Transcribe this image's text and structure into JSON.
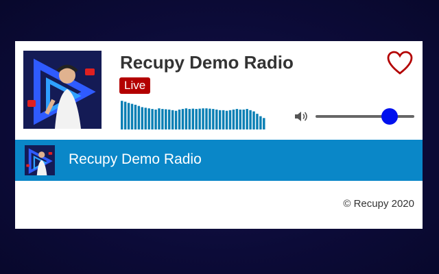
{
  "station": {
    "title": "Recupy Demo Radio",
    "live_label": "Live"
  },
  "volume": {
    "level": 0.75
  },
  "spectrum": {
    "levels": [
      0.95,
      0.92,
      0.88,
      0.85,
      0.82,
      0.78,
      0.74,
      0.72,
      0.7,
      0.68,
      0.66,
      0.7,
      0.68,
      0.67,
      0.66,
      0.64,
      0.62,
      0.66,
      0.68,
      0.7,
      0.68,
      0.69,
      0.68,
      0.69,
      0.7,
      0.7,
      0.69,
      0.68,
      0.66,
      0.64,
      0.64,
      0.62,
      0.64,
      0.66,
      0.68,
      0.66,
      0.66,
      0.68,
      0.64,
      0.6,
      0.52,
      0.44,
      0.38
    ],
    "color": "#0a7fb4"
  },
  "now_playing": {
    "title": "Recupy Demo Radio"
  },
  "footer": {
    "copyright": "© Recupy 2020"
  },
  "colors": {
    "accent": "#0a87c8",
    "live": "#b30000",
    "heart": "#b30000",
    "slider_thumb": "#0011ee"
  },
  "icons": {
    "favorite": "heart-icon",
    "volume": "speaker-icon"
  }
}
